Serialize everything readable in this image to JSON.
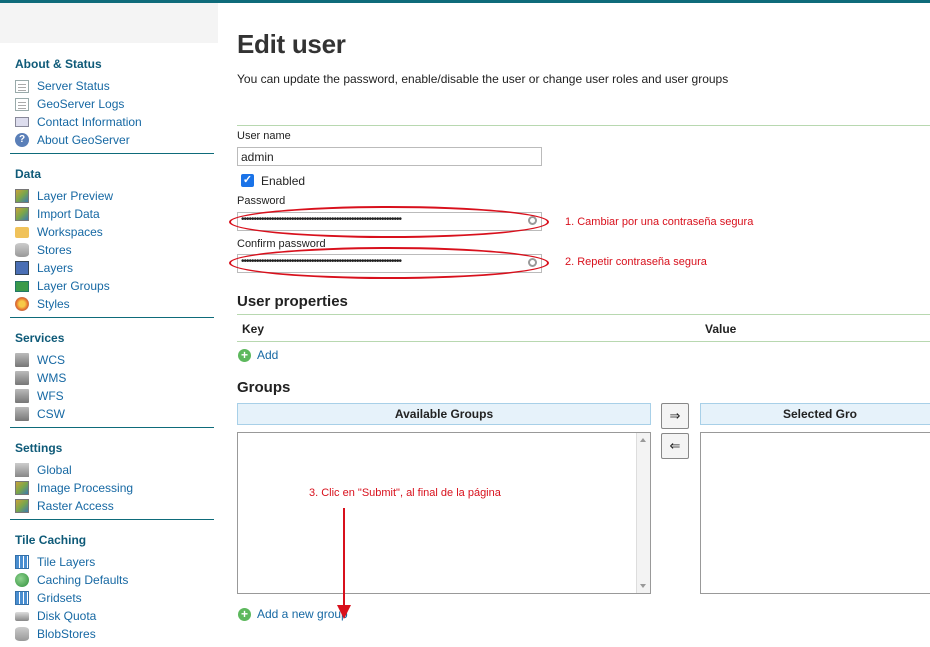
{
  "sidebar": {
    "sections": [
      {
        "title": "About & Status",
        "items": [
          {
            "label": "Server Status",
            "icon": "warning-doc-icon"
          },
          {
            "label": "GeoServer Logs",
            "icon": "document-icon"
          },
          {
            "label": "Contact Information",
            "icon": "contact-card-icon"
          },
          {
            "label": "About GeoServer",
            "icon": "info-icon"
          }
        ]
      },
      {
        "title": "Data",
        "items": [
          {
            "label": "Layer Preview",
            "icon": "map-icon"
          },
          {
            "label": "Import Data",
            "icon": "map-icon"
          },
          {
            "label": "Workspaces",
            "icon": "folder-icon"
          },
          {
            "label": "Stores",
            "icon": "database-icon"
          },
          {
            "label": "Layers",
            "icon": "layers-icon"
          },
          {
            "label": "Layer Groups",
            "icon": "layer-group-icon"
          },
          {
            "label": "Styles",
            "icon": "palette-icon"
          }
        ]
      },
      {
        "title": "Services",
        "items": [
          {
            "label": "WCS",
            "icon": "server-icon"
          },
          {
            "label": "WMS",
            "icon": "server-icon"
          },
          {
            "label": "WFS",
            "icon": "server-icon"
          },
          {
            "label": "CSW",
            "icon": "server-icon"
          }
        ]
      },
      {
        "title": "Settings",
        "items": [
          {
            "label": "Global",
            "icon": "server-icon"
          },
          {
            "label": "Image Processing",
            "icon": "map-icon"
          },
          {
            "label": "Raster Access",
            "icon": "map-icon"
          }
        ]
      },
      {
        "title": "Tile Caching",
        "items": [
          {
            "label": "Tile Layers",
            "icon": "grid-icon"
          },
          {
            "label": "Caching Defaults",
            "icon": "globe-icon"
          },
          {
            "label": "Gridsets",
            "icon": "grid-icon"
          },
          {
            "label": "Disk Quota",
            "icon": "disk-icon"
          },
          {
            "label": "BlobStores",
            "icon": "database-icon"
          }
        ]
      }
    ]
  },
  "main": {
    "title": "Edit user",
    "description": "You can update the password, enable/disable the user or change user roles and user groups",
    "username_label": "User name",
    "username_value": "admin",
    "enabled_label": "Enabled",
    "enabled_checked": true,
    "password_label": "Password",
    "password_value": "••••••••••••••••••••••••••••••••••••••••••••••••••••••••••••••••",
    "confirm_label": "Confirm password",
    "confirm_value": "••••••••••••••••••••••••••••••••••••••••••••••••••••••••••••••••",
    "user_properties_title": "User properties",
    "key_header": "Key",
    "value_header": "Value",
    "add_label": "Add",
    "groups_title": "Groups",
    "available_groups_header": "Available Groups",
    "selected_groups_header": "Selected Gro",
    "move_right": "⇒",
    "move_left": "⇐",
    "add_group_label": "Add a new group"
  },
  "annotations": {
    "note1": "1. Cambiar por una contraseña segura",
    "note2": "2. Repetir contraseña segura",
    "note3": "3. Clic en \"Submit\", al final de la página",
    "color": "#d8101c"
  },
  "colors": {
    "accent": "#0e6b7a",
    "link": "#1668a3",
    "header_bg": "#e6f2fa"
  }
}
